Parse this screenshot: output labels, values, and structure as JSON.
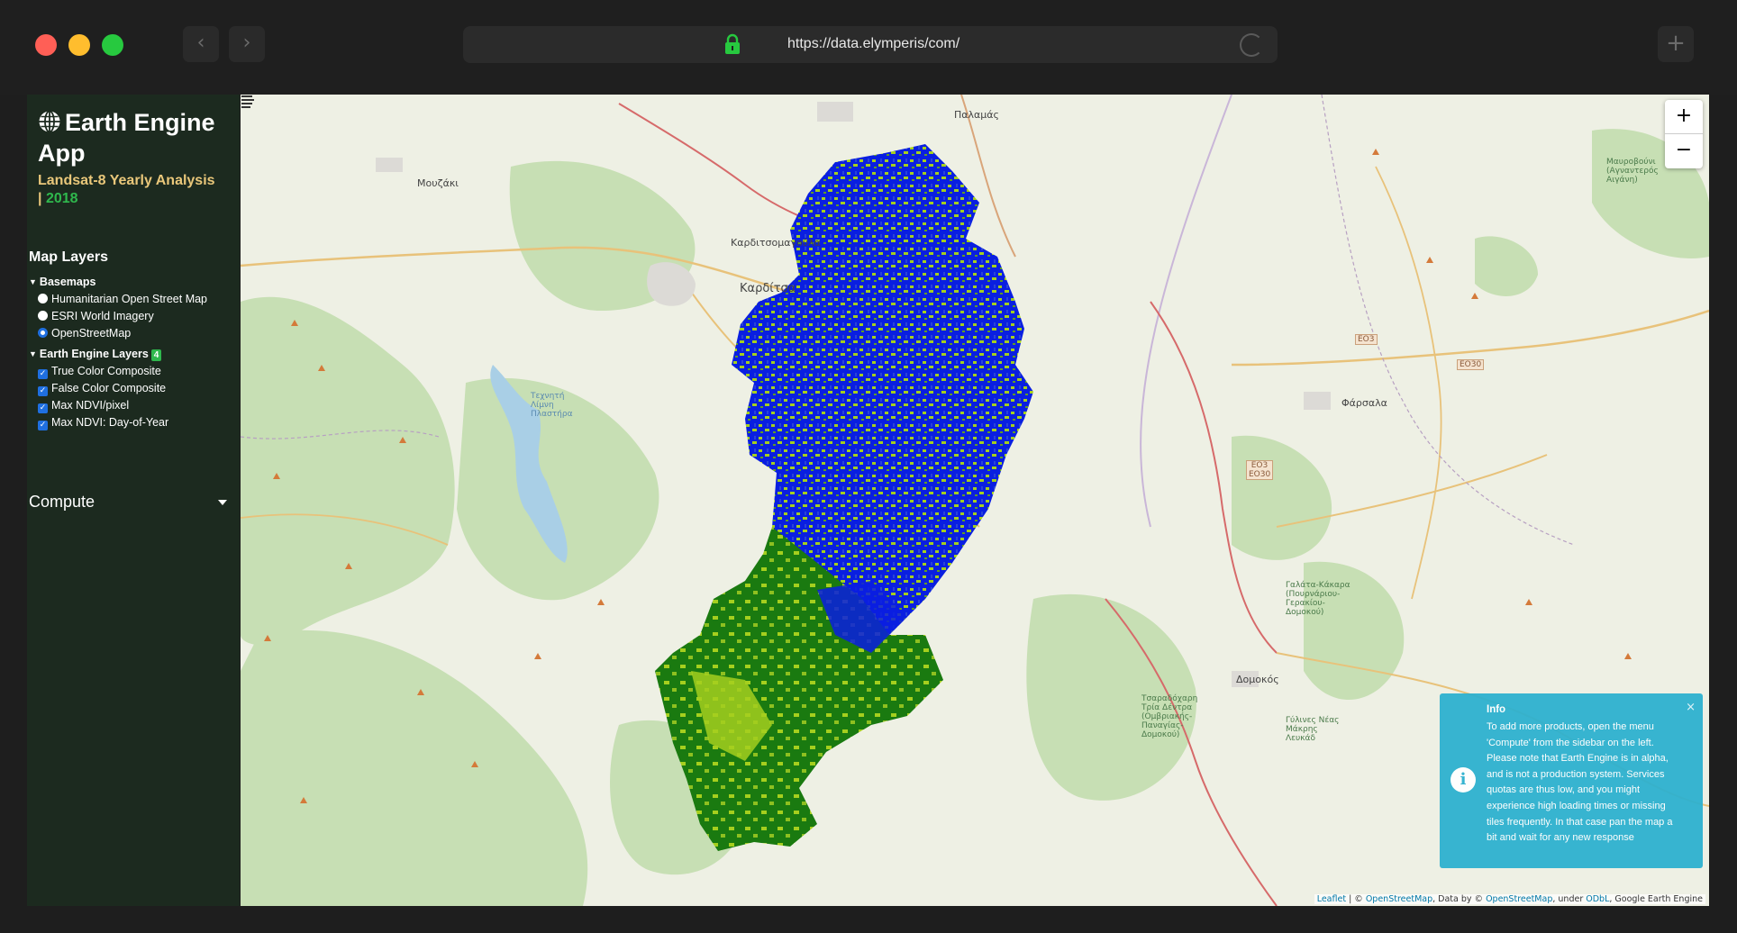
{
  "browser": {
    "url": "https://data.elymperis/com/",
    "back_glyph": "‹",
    "forward_glyph": "›",
    "newtab_glyph": "+"
  },
  "sidebar": {
    "title": "Earth Engine App",
    "subtitle": "Landsat-8 Yearly Analysis",
    "separator": "|",
    "year": "2018",
    "map_layers_title": "Map Layers",
    "basemaps": {
      "label": "Basemaps",
      "options": [
        "Humanitarian Open Street Map",
        "ESRI World Imagery",
        "OpenStreetMap"
      ],
      "selected": "OpenStreetMap"
    },
    "ee_layers": {
      "label": "Earth Engine Layers",
      "count": "4",
      "items": [
        "True Color Composite",
        "False Color Composite",
        "Max NDVI/pixel",
        "Max NDVI: Day-of-Year"
      ]
    },
    "compute_label": "Compute"
  },
  "map": {
    "places": [
      "Παλαμάς",
      "Μουζάκι",
      "Καρδιτσομαγούλα",
      "Καρδίτσα",
      "Φάρσαλα",
      "Δομοκός",
      "Τεχνητή Λίμνη Πλαστήρα",
      "Μαυροβούνι (Αγναντερός Αιγάνη)",
      "Γαλάτα-Κάκαρα (Πουρνάριου-Γερακίου-Δομοκού)",
      "Τσαραδόχαρη Τρία Δέντρα (Ομβριακής-Παναγίας-Δομοκού)",
      "Γύλινες Νέας Μάκρης Λευκάδ"
    ],
    "roads": [
      "EO3",
      "EO30",
      "EO3 EO30"
    ],
    "zoom_in": "+",
    "zoom_out": "−",
    "attribution": {
      "leaflet": "Leaflet",
      "sep1": " | © ",
      "osm": "OpenStreetMap",
      "mid": ", Data by © ",
      "osm2": "OpenStreetMap",
      "under": ", under ",
      "odbl": "ODbL",
      "tail": ", Google Earth Engine"
    },
    "colors": {
      "blue": "#0a1fe0",
      "lime": "#a5cf1e",
      "green": "#1a7a10",
      "forest": "#c7dfb4"
    }
  },
  "toast": {
    "title": "Info",
    "close": "×",
    "icon": "i",
    "body": "To add more products, open the menu 'Compute' from the sidebar on the left. Please note that Earth Engine is in alpha, and is not a production system. Services quotas are thus low, and you might experience high loading times or missing tiles frequently. In that case pan the map a bit and wait for any new response"
  }
}
